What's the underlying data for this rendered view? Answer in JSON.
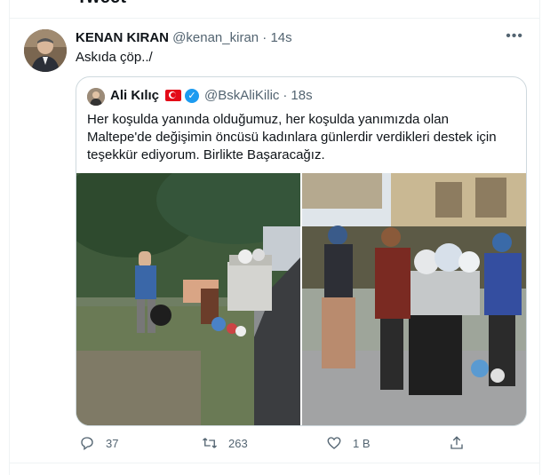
{
  "page": {
    "header_title": "Tweet"
  },
  "tweet": {
    "author_name": "KENAN KIRAN",
    "author_handle": "@kenan_kiran",
    "separator": "·",
    "time": "14s",
    "text": "Askıda çöp../",
    "more_icon": "more-horizontal-icon"
  },
  "quoted_tweet": {
    "author_name": "Ali Kılıç",
    "author_handle": "@BskAliKilic",
    "separator": "·",
    "time": "18s",
    "flag_icon": "turkey-flag-icon",
    "verified_icon": "verified-badge-icon",
    "text": "Her koşulda yanında olduğumuz, her koşulda yanımızda olan Maltepe'de değişimin öncüsü kadınlara günlerdir verdikleri destek için teşekkür ediyorum. Birlikte Başaracağız.",
    "photos": [
      "photo-left-street-garbage",
      "photo-right-women-garbage"
    ]
  },
  "actions": {
    "reply_count": "37",
    "retweet_count": "263",
    "like_count": "1 B",
    "colors": {
      "icon": "#536471",
      "accent": "#1d9bf0"
    }
  }
}
